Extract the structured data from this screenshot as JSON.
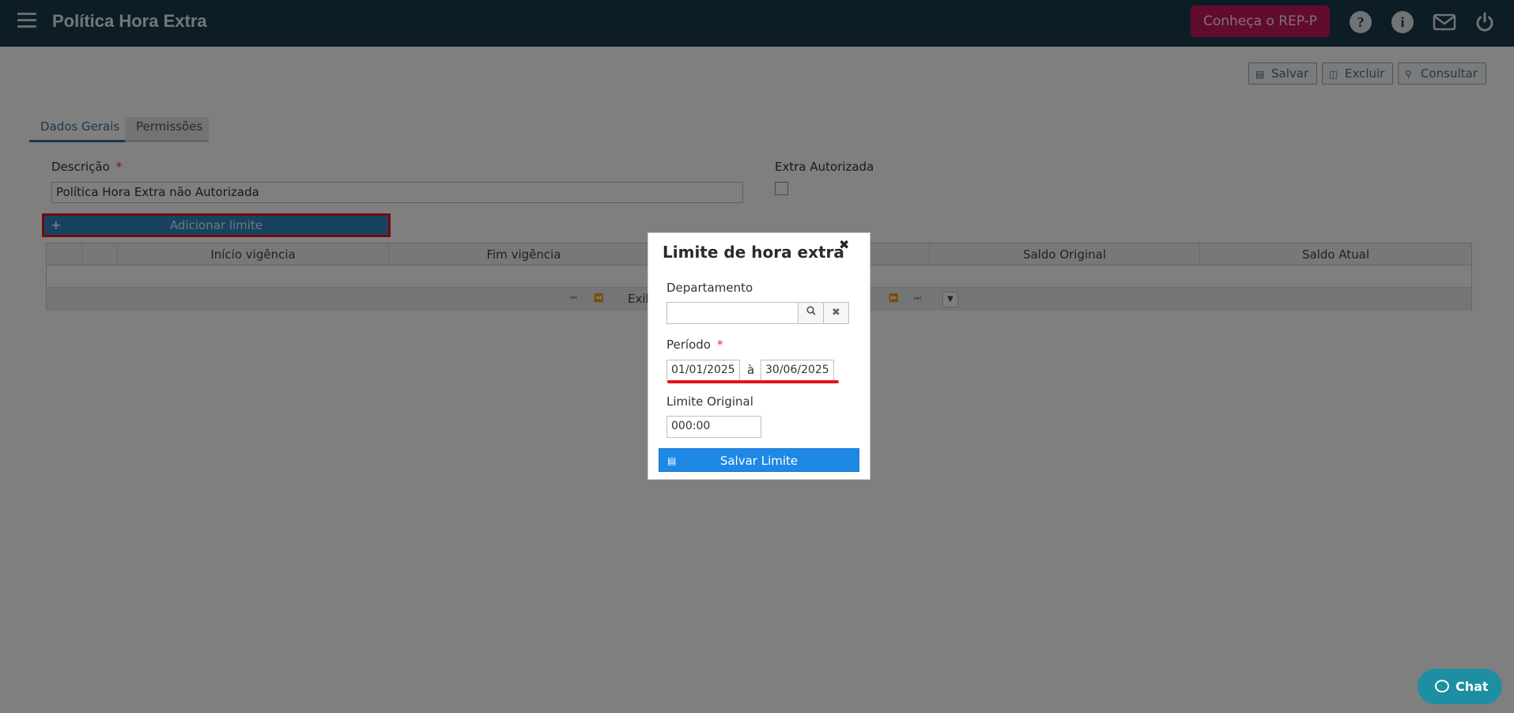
{
  "header": {
    "title": "Política Hora Extra",
    "rep_button": "Conheça o REP-P",
    "icons": [
      "menu-icon",
      "help-icon",
      "info-icon",
      "mail-icon",
      "power-icon"
    ]
  },
  "toolbar": {
    "save": "Salvar",
    "delete": "Excluir",
    "search": "Consultar"
  },
  "tabs": [
    {
      "label": "Dados Gerais",
      "active": true
    },
    {
      "label": "Permissões",
      "active": false
    }
  ],
  "form": {
    "description_label": "Descrição",
    "description_value": "Política Hora Extra não Autorizada",
    "authorized_label": "Extra Autorizada",
    "add_limit": "Adicionar limite"
  },
  "grid": {
    "columns": [
      "Início vigência",
      "Fim vigência",
      "",
      "Saldo Original",
      "Saldo Atual"
    ],
    "footer_text": "Exib"
  },
  "modal": {
    "title": "Limite de hora extra",
    "department_label": "Departamento",
    "department_value": "",
    "period_label": "Período",
    "period_start": "01/01/2025",
    "period_sep": "à",
    "period_end": "30/06/2025",
    "limit_label": "Limite Original",
    "limit_value": "000:00",
    "save_button": "Salvar Limite"
  },
  "chat": {
    "label": "Chat"
  },
  "colors": {
    "topbar": "#1b3a4b",
    "rep_button": "#c2185b",
    "primary": "#1e88e5",
    "highlight": "#e4141b",
    "chat": "#1e8fa3"
  }
}
